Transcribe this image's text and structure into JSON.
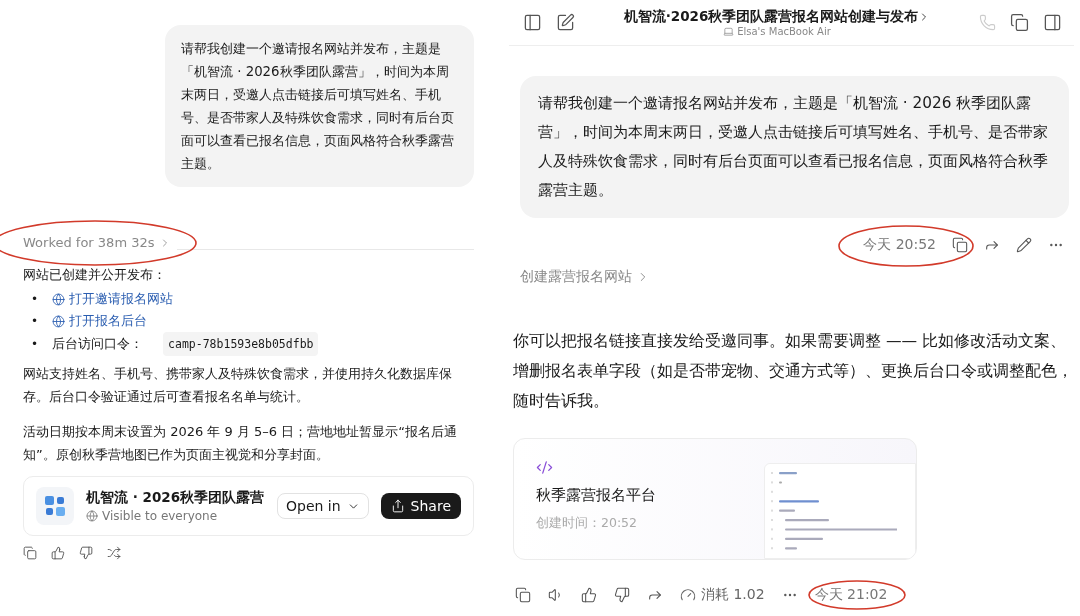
{
  "left": {
    "user_message": "请帮我创建一个邀请报名网站并发布，主题是「机智流 · 2026秋季团队露营」，时间为本周末两日，受邀人点击链接后可填写姓名、手机号、是否带家人及特殊饮食需求，同时有后台页面可以查看已报名信息，页面风格符合秋季露营主题。",
    "worked": "Worked for 38m 32s",
    "intro": "网站已创建并公开发布：",
    "bullets": [
      {
        "kind": "link",
        "marker": "•",
        "text": "打开邀请报名网站"
      },
      {
        "kind": "link",
        "marker": "•",
        "text": "打开报名后台"
      },
      {
        "kind": "code",
        "marker": "•",
        "text": "后台访问口令：",
        "code": "camp-78b1593e8b05dfbb"
      }
    ],
    "paragraphs": [
      "网站支持姓名、手机号、携带家人及特殊饮食需求，并使用持久化数据库保存。后台口令验证通过后可查看报名名单与统计。",
      "活动日期按本周末设置为 2026 年 9 月 5–6 日；营地地址暂显示“报名后通知”。原创秋季营地图已作为页面主视觉和分享封面。"
    ],
    "card": {
      "title": "机智流 · 2026秋季团队露营",
      "visibility": "Visible to everyone",
      "open_button": "Open in",
      "share_button": "Share"
    }
  },
  "right": {
    "title": "机智流·2026秋季团队露营报名网站创建与发布",
    "device": "Elsa's MacBook Air",
    "user_message": "请帮我创建一个邀请报名网站并发布，主题是「机智流 · 2026 秋季团队露营」，时间为本周末两日，受邀人点击链接后可填写姓名、手机号、是否带家人及特殊饮食需求，同时有后台页面可以查看已报名信息，页面风格符合秋季露营主题。",
    "message_time": "今天 20:52",
    "task_link": "创建露营报名网站",
    "reply": "你可以把报名链接直接发给受邀同事。如果需要调整 —— 比如修改活动文案、增删报名表单字段（如是否带宠物、交通方式等）、更换后台口令或调整配色，随时告诉我。",
    "card": {
      "title": "秋季露营报名平台",
      "created": "创建时间：20:52"
    },
    "usage": "消耗 1.02",
    "reply_time": "今天 21:02"
  }
}
